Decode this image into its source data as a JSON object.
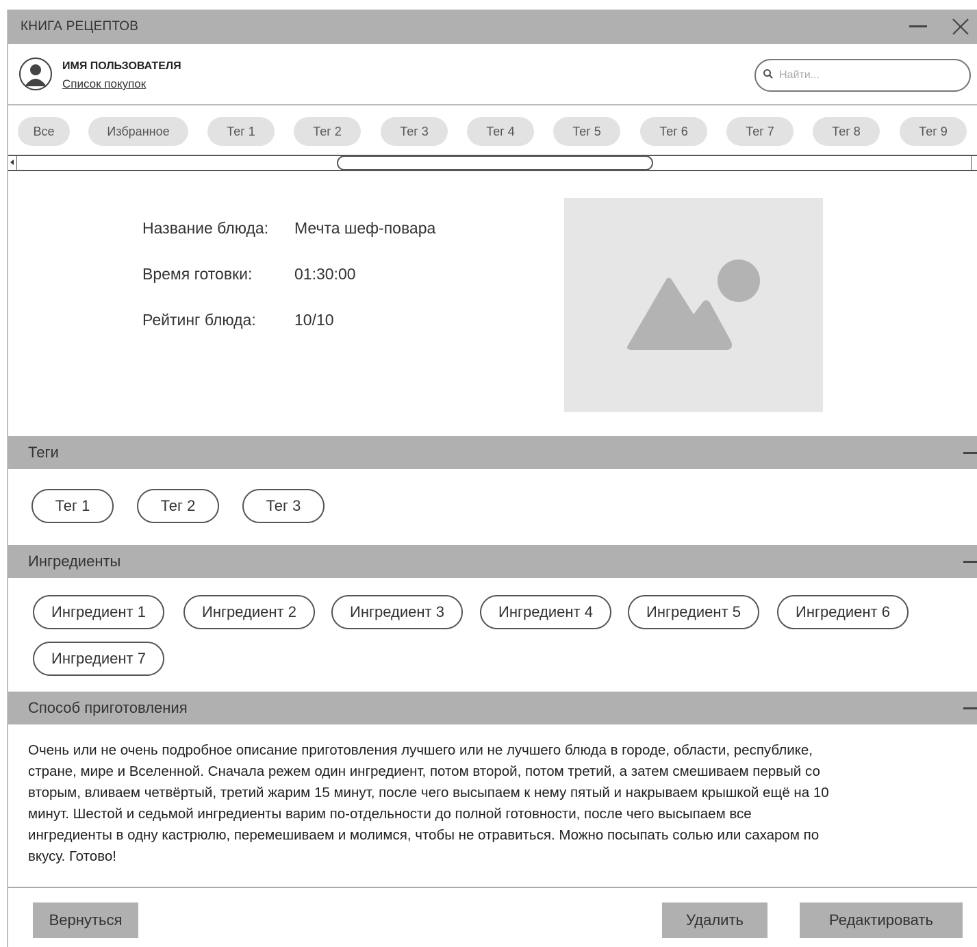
{
  "window": {
    "title": "КНИГА РЕЦЕПТОВ"
  },
  "header": {
    "username": "ИМЯ ПОЛЬЗОВАТЕЛЯ",
    "shopping_list": "Список покупок",
    "search_placeholder": "Найти..."
  },
  "filters": [
    "Все",
    "Избранное",
    "Тег 1",
    "Тег 2",
    "Тег 3",
    "Тег 4",
    "Тег 5",
    "Тег 6",
    "Тег 7",
    "Тег 8",
    "Тег 9"
  ],
  "details": {
    "name_label": "Название блюда:",
    "name_value": "Мечта шеф-повара",
    "time_label": "Время готовки:",
    "time_value": "01:30:00",
    "rating_label": "Рейтинг блюда:",
    "rating_value": "10/10"
  },
  "tags_section": {
    "title": "Теги",
    "items": [
      "Тег 1",
      "Тег 2",
      "Тег 3"
    ]
  },
  "ingredients_section": {
    "title": "Ингредиенты",
    "items": [
      "Ингредиент 1",
      "Ингредиент 2",
      "Ингредиент 3",
      "Ингредиент 4",
      "Ингредиент 5",
      "Ингредиент 6",
      "Ингредиент 7"
    ]
  },
  "method_section": {
    "title": "Способ приготовления",
    "lines": [
      "Очень или не очень подробное описание приготовления лучшего или не лучшего блюда в городе, области, республике,",
      "стране, мире и Вселенной. Сначала режем один ингредиент, потом второй, потом третий, а затем смешиваем первый со",
      "вторым, вливаем четвёртый, третий жарим 15 минут, после чего высыпаем к нему пятый и накрываем крышкой ещё на 10",
      "минут. Шестой и седьмой ингредиенты варим по-отдельности до полной готовности, после чего высыпаем все",
      "ингредиенты в одну кастрюлю, перемешиваем и молимся, чтобы не отравиться. Можно посыпать солью или сахаром по",
      "вкусу. Готово!"
    ]
  },
  "footer": {
    "back": "Вернуться",
    "delete": "Удалить",
    "edit": "Редактировать"
  }
}
